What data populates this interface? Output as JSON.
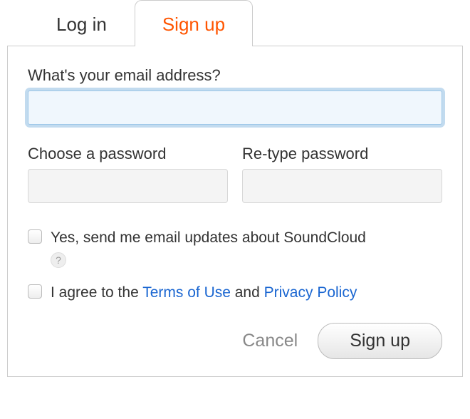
{
  "tabs": {
    "login": "Log in",
    "signup": "Sign up"
  },
  "form": {
    "email_label": "What's your email address?",
    "email_value": "",
    "password_label": "Choose a password",
    "password_value": "",
    "repassword_label": "Re-type password",
    "repassword_value": ""
  },
  "checkboxes": {
    "updates_label": "Yes, send me email updates about SoundCloud",
    "agree_prefix": "I agree to the ",
    "terms_link": "Terms of Use",
    "agree_mid": " and ",
    "privacy_link": "Privacy Policy"
  },
  "actions": {
    "cancel": "Cancel",
    "signup": "Sign up"
  },
  "colors": {
    "accent": "#f50",
    "link": "#1a66d1"
  }
}
